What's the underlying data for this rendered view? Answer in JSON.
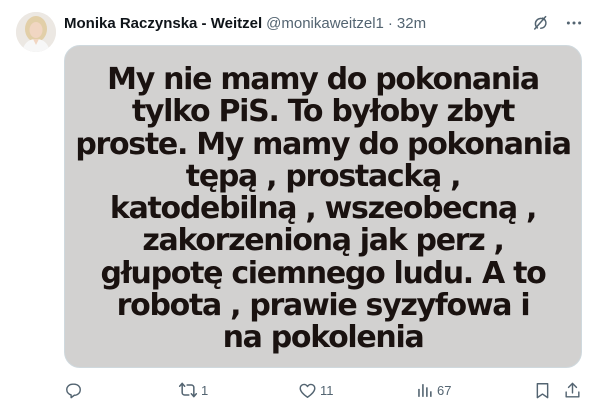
{
  "author": {
    "name": "Monika Raczynska - Weitzel",
    "handle": "@monikaweitzel1",
    "separator": "·",
    "time": "32m"
  },
  "header_icons": [
    "grok-icon",
    "more-icon"
  ],
  "media": {
    "lines": [
      "My nie mamy do pokonania",
      "tylko PiS. To byłoby zbyt",
      "proste. My mamy do pokonania",
      "tępą , prostacką ,",
      "katodebilną , wszeobecną ,",
      "zakorzenioną jak perz ,",
      "głupotę ciemnego ludu. A to",
      "robota , prawie syzyfowa i",
      "na pokolenia"
    ]
  },
  "actions": {
    "reply": {
      "icon": "reply-icon",
      "count": ""
    },
    "repost": {
      "icon": "repost-icon",
      "count": "1"
    },
    "like": {
      "icon": "like-icon",
      "count": "11"
    },
    "views": {
      "icon": "views-icon",
      "count": "67"
    },
    "bookmark": {
      "icon": "bookmark-icon"
    },
    "share": {
      "icon": "share-icon"
    }
  },
  "colors": {
    "text": "#0f1419",
    "secondary": "#536471",
    "border": "#cfd9de",
    "media_bg": "#d2d1d0",
    "media_text": "#1a1210"
  }
}
